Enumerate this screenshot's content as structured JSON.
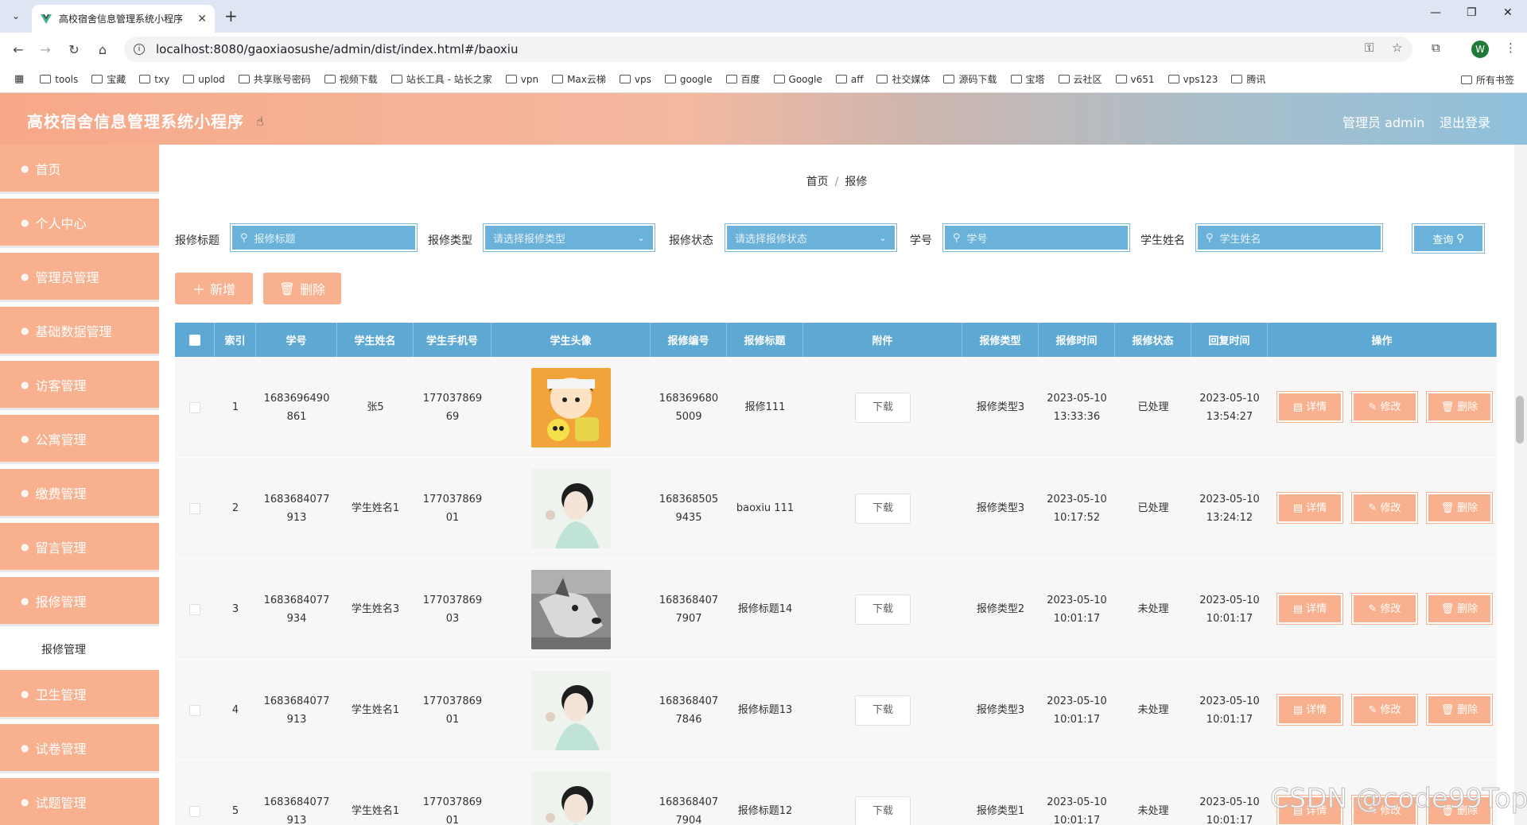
{
  "browser": {
    "tab_title": "高校宿舍信息管理系统小程序",
    "new_tab_label": "+",
    "url": "localhost:8080/gaoxiaosushe/admin/dist/index.html#/baoxiu",
    "profile_initial": "W",
    "bookmarks": [
      "tools",
      "宝藏",
      "txy",
      "uplod",
      "共享账号密码",
      "视频下载",
      "站长工具 - 站长之家",
      "vpn",
      "Max云梯",
      "vps",
      "google",
      "百度",
      "Google",
      "aff",
      "社交媒体",
      "源码下载",
      "宝塔",
      "云社区",
      "v651",
      "vps123",
      "腾讯"
    ],
    "all_bookmarks": "所有书签"
  },
  "header": {
    "title": "高校宿舍信息管理系统小程序",
    "user": "管理员 admin",
    "logout": "退出登录"
  },
  "sidebar": {
    "items": [
      "首页",
      "个人中心",
      "管理员管理",
      "基础数据管理",
      "访客管理",
      "公寓管理",
      "缴费管理",
      "留言管理",
      "报修管理",
      "卫生管理",
      "试卷管理",
      "试题管理"
    ],
    "active_sub": "报修管理"
  },
  "breadcrumb": {
    "home": "首页",
    "sep": "/",
    "current": "报修"
  },
  "filters": {
    "title_label": "报修标题",
    "title_placeholder": "报修标题",
    "type_label": "报修类型",
    "type_placeholder": "请选择报修类型",
    "status_label": "报修状态",
    "status_placeholder": "请选择报修状态",
    "sno_label": "学号",
    "sno_placeholder": "学号",
    "name_label": "学生姓名",
    "name_placeholder": "学生姓名",
    "query": "查询"
  },
  "actions": {
    "add": "新增",
    "delete": "删除"
  },
  "table": {
    "headers": [
      "索引",
      "学号",
      "学生姓名",
      "学生手机号",
      "学生头像",
      "报修编号",
      "报修标题",
      "附件",
      "报修类型",
      "报修时间",
      "报修状态",
      "回复时间",
      "操作"
    ],
    "download": "下载",
    "op_detail": "详情",
    "op_edit": "修改",
    "op_delete": "删除",
    "rows": [
      {
        "index": "1",
        "sno": [
          "1683696490",
          "861"
        ],
        "name": "张5",
        "phone": [
          "177037869",
          "69"
        ],
        "avatar": "cartoon",
        "code": [
          "168369680",
          "5009"
        ],
        "title": "报修111",
        "type": "报修类型3",
        "time": [
          "2023-05-10",
          "13:33:36"
        ],
        "status": "已处理",
        "reply": [
          "2023-05-10",
          "13:54:27"
        ]
      },
      {
        "index": "2",
        "sno": [
          "1683684077",
          "913"
        ],
        "name": "学生姓名1",
        "phone": [
          "177037869",
          "01"
        ],
        "avatar": "woman",
        "code": [
          "168368505",
          "9435"
        ],
        "title": "baoxiu 111",
        "type": "报修类型3",
        "time": [
          "2023-05-10",
          "10:17:52"
        ],
        "status": "已处理",
        "reply": [
          "2023-05-10",
          "13:24:12"
        ]
      },
      {
        "index": "3",
        "sno": [
          "1683684077",
          "934"
        ],
        "name": "学生姓名3",
        "phone": [
          "177037869",
          "03"
        ],
        "avatar": "dog",
        "code": [
          "168368407",
          "7907"
        ],
        "title": "报修标题14",
        "type": "报修类型2",
        "time": [
          "2023-05-10",
          "10:01:17"
        ],
        "status": "未处理",
        "reply": [
          "2023-05-10",
          "10:01:17"
        ]
      },
      {
        "index": "4",
        "sno": [
          "1683684077",
          "913"
        ],
        "name": "学生姓名1",
        "phone": [
          "177037869",
          "01"
        ],
        "avatar": "woman",
        "code": [
          "168368407",
          "7846"
        ],
        "title": "报修标题13",
        "type": "报修类型3",
        "time": [
          "2023-05-10",
          "10:01:17"
        ],
        "status": "未处理",
        "reply": [
          "2023-05-10",
          "10:01:17"
        ]
      },
      {
        "index": "5",
        "sno": [
          "1683684077",
          "913"
        ],
        "name": "学生姓名1",
        "phone": [
          "177037869",
          "01"
        ],
        "avatar": "woman",
        "code": [
          "168368407",
          "7904"
        ],
        "title": "报修标题12",
        "type": "报修类型1",
        "time": [
          "2023-05-10",
          "10:01:17"
        ],
        "status": "未处理",
        "reply": [
          "2023-05-10",
          "10:01:17"
        ]
      }
    ]
  },
  "watermark": "CSDN @code99Top"
}
